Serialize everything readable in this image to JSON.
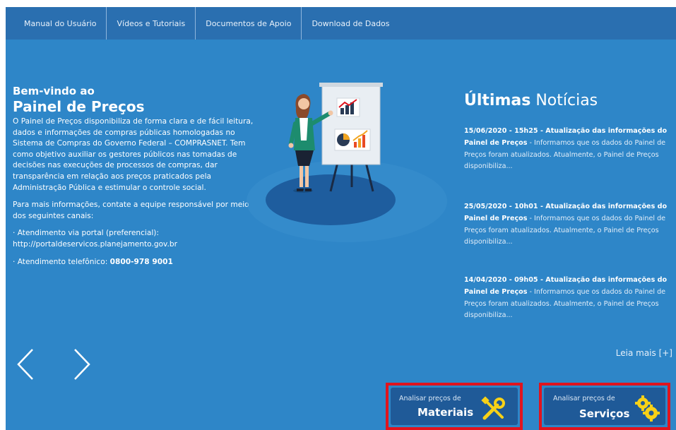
{
  "nav": {
    "items": [
      "Manual do Usuário",
      "Vídeos e Tutoriais",
      "Documentos de Apoio",
      "Download de Dados"
    ]
  },
  "welcome": {
    "line1": "Bem-vindo ao",
    "line2": "Painel de Preços",
    "description": "O Painel de Preços disponibiliza de forma clara e de fácil leitura, dados e informações de compras públicas homologadas no Sistema de Compras do Governo Federal – COMPRASNET. Tem como objetivo auxiliar os gestores públicos nas tomadas de decisões nas execuções de processos de compras, dar transparência em relação aos preços praticados pela Administração Pública e estimular o controle social.",
    "contact_intro": "Para mais informações, contate a equipe responsável por meio dos seguintes canais:",
    "portal_label": "· Atendimento via portal (preferencial):",
    "portal_url": "http://portaldeservicos.planejamento.gov.br",
    "phone_label": "· Atendimento telefônico: ",
    "phone_number": "0800-978 9001"
  },
  "news": {
    "title_bold": "Últimas",
    "title_light": "Notícias",
    "items": [
      {
        "headline": "15/06/2020 - 15h25 - Atualização das informações do Painel de Preços",
        "summary": " - Informamos que os dados do Painel de Preços foram atualizados. Atualmente, o Painel de Preços disponibiliza..."
      },
      {
        "headline": "25/05/2020 - 10h01 - Atualização das informações do Painel de Preços",
        "summary": " - Informamos que os dados do Painel de Preços foram atualizados. Atualmente, o Painel de Preços disponibiliza..."
      },
      {
        "headline": "14/04/2020 - 09h05 - Atualização das informações do Painel de Preços",
        "summary": " - Informamos que os dados do Painel de Preços foram atualizados. Atualmente, o Painel de Preços disponibiliza..."
      }
    ],
    "read_more": "Leia mais [+]"
  },
  "actions": {
    "materiais": {
      "small": "Analisar preços de",
      "big": "Materiais",
      "icon": "tools-icon"
    },
    "servicos": {
      "small": "Analisar preços de",
      "big": "Serviços",
      "icon": "gears-icon"
    }
  },
  "colors": {
    "background": "#2e86c8",
    "nav": "#2a6fb0",
    "button": "#1f5a98",
    "highlight": "#e0141e",
    "icon_yellow": "#f7d117"
  }
}
